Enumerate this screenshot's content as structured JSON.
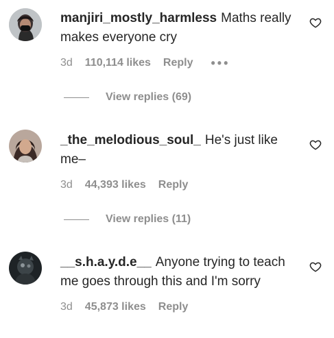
{
  "comments": [
    {
      "username": "manjiri_mostly_harmless",
      "text": "Maths really makes everyone cry",
      "age": "3d",
      "likes": "110,114 likes",
      "reply_label": "Reply",
      "more_label": "•••",
      "view_replies": "View replies (69)"
    },
    {
      "username": "_the_melodious_soul_",
      "text": "He's just like me–",
      "age": "3d",
      "likes": "44,393 likes",
      "reply_label": "Reply",
      "view_replies": "View replies (11)"
    },
    {
      "username": "__s.h.a.y.d.e__",
      "text": "Anyone trying to teach me goes through this and I'm sorry",
      "age": "3d",
      "likes": "45,873 likes",
      "reply_label": "Reply"
    }
  ],
  "icons": {
    "like": "heart-outline-icon",
    "more": "more-options-icon"
  },
  "colors": {
    "text": "#262626",
    "secondary": "#8e8e8e",
    "background": "#ffffff"
  }
}
